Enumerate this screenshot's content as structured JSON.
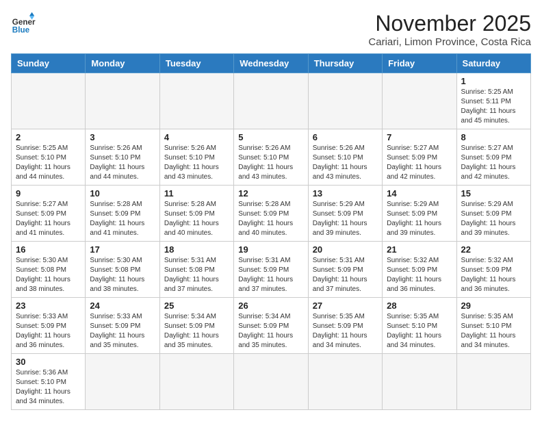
{
  "header": {
    "logo_general": "General",
    "logo_blue": "Blue",
    "month_title": "November 2025",
    "subtitle": "Cariari, Limon Province, Costa Rica"
  },
  "weekdays": [
    "Sunday",
    "Monday",
    "Tuesday",
    "Wednesday",
    "Thursday",
    "Friday",
    "Saturday"
  ],
  "weeks": [
    [
      {
        "day": "",
        "info": ""
      },
      {
        "day": "",
        "info": ""
      },
      {
        "day": "",
        "info": ""
      },
      {
        "day": "",
        "info": ""
      },
      {
        "day": "",
        "info": ""
      },
      {
        "day": "",
        "info": ""
      },
      {
        "day": "1",
        "info": "Sunrise: 5:25 AM\nSunset: 5:11 PM\nDaylight: 11 hours\nand 45 minutes."
      }
    ],
    [
      {
        "day": "2",
        "info": "Sunrise: 5:25 AM\nSunset: 5:10 PM\nDaylight: 11 hours\nand 44 minutes."
      },
      {
        "day": "3",
        "info": "Sunrise: 5:26 AM\nSunset: 5:10 PM\nDaylight: 11 hours\nand 44 minutes."
      },
      {
        "day": "4",
        "info": "Sunrise: 5:26 AM\nSunset: 5:10 PM\nDaylight: 11 hours\nand 43 minutes."
      },
      {
        "day": "5",
        "info": "Sunrise: 5:26 AM\nSunset: 5:10 PM\nDaylight: 11 hours\nand 43 minutes."
      },
      {
        "day": "6",
        "info": "Sunrise: 5:26 AM\nSunset: 5:10 PM\nDaylight: 11 hours\nand 43 minutes."
      },
      {
        "day": "7",
        "info": "Sunrise: 5:27 AM\nSunset: 5:09 PM\nDaylight: 11 hours\nand 42 minutes."
      },
      {
        "day": "8",
        "info": "Sunrise: 5:27 AM\nSunset: 5:09 PM\nDaylight: 11 hours\nand 42 minutes."
      }
    ],
    [
      {
        "day": "9",
        "info": "Sunrise: 5:27 AM\nSunset: 5:09 PM\nDaylight: 11 hours\nand 41 minutes."
      },
      {
        "day": "10",
        "info": "Sunrise: 5:28 AM\nSunset: 5:09 PM\nDaylight: 11 hours\nand 41 minutes."
      },
      {
        "day": "11",
        "info": "Sunrise: 5:28 AM\nSunset: 5:09 PM\nDaylight: 11 hours\nand 40 minutes."
      },
      {
        "day": "12",
        "info": "Sunrise: 5:28 AM\nSunset: 5:09 PM\nDaylight: 11 hours\nand 40 minutes."
      },
      {
        "day": "13",
        "info": "Sunrise: 5:29 AM\nSunset: 5:09 PM\nDaylight: 11 hours\nand 39 minutes."
      },
      {
        "day": "14",
        "info": "Sunrise: 5:29 AM\nSunset: 5:09 PM\nDaylight: 11 hours\nand 39 minutes."
      },
      {
        "day": "15",
        "info": "Sunrise: 5:29 AM\nSunset: 5:09 PM\nDaylight: 11 hours\nand 39 minutes."
      }
    ],
    [
      {
        "day": "16",
        "info": "Sunrise: 5:30 AM\nSunset: 5:08 PM\nDaylight: 11 hours\nand 38 minutes."
      },
      {
        "day": "17",
        "info": "Sunrise: 5:30 AM\nSunset: 5:08 PM\nDaylight: 11 hours\nand 38 minutes."
      },
      {
        "day": "18",
        "info": "Sunrise: 5:31 AM\nSunset: 5:08 PM\nDaylight: 11 hours\nand 37 minutes."
      },
      {
        "day": "19",
        "info": "Sunrise: 5:31 AM\nSunset: 5:09 PM\nDaylight: 11 hours\nand 37 minutes."
      },
      {
        "day": "20",
        "info": "Sunrise: 5:31 AM\nSunset: 5:09 PM\nDaylight: 11 hours\nand 37 minutes."
      },
      {
        "day": "21",
        "info": "Sunrise: 5:32 AM\nSunset: 5:09 PM\nDaylight: 11 hours\nand 36 minutes."
      },
      {
        "day": "22",
        "info": "Sunrise: 5:32 AM\nSunset: 5:09 PM\nDaylight: 11 hours\nand 36 minutes."
      }
    ],
    [
      {
        "day": "23",
        "info": "Sunrise: 5:33 AM\nSunset: 5:09 PM\nDaylight: 11 hours\nand 36 minutes."
      },
      {
        "day": "24",
        "info": "Sunrise: 5:33 AM\nSunset: 5:09 PM\nDaylight: 11 hours\nand 35 minutes."
      },
      {
        "day": "25",
        "info": "Sunrise: 5:34 AM\nSunset: 5:09 PM\nDaylight: 11 hours\nand 35 minutes."
      },
      {
        "day": "26",
        "info": "Sunrise: 5:34 AM\nSunset: 5:09 PM\nDaylight: 11 hours\nand 35 minutes."
      },
      {
        "day": "27",
        "info": "Sunrise: 5:35 AM\nSunset: 5:09 PM\nDaylight: 11 hours\nand 34 minutes."
      },
      {
        "day": "28",
        "info": "Sunrise: 5:35 AM\nSunset: 5:10 PM\nDaylight: 11 hours\nand 34 minutes."
      },
      {
        "day": "29",
        "info": "Sunrise: 5:35 AM\nSunset: 5:10 PM\nDaylight: 11 hours\nand 34 minutes."
      }
    ],
    [
      {
        "day": "30",
        "info": "Sunrise: 5:36 AM\nSunset: 5:10 PM\nDaylight: 11 hours\nand 34 minutes."
      },
      {
        "day": "",
        "info": ""
      },
      {
        "day": "",
        "info": ""
      },
      {
        "day": "",
        "info": ""
      },
      {
        "day": "",
        "info": ""
      },
      {
        "day": "",
        "info": ""
      },
      {
        "day": "",
        "info": ""
      }
    ]
  ]
}
